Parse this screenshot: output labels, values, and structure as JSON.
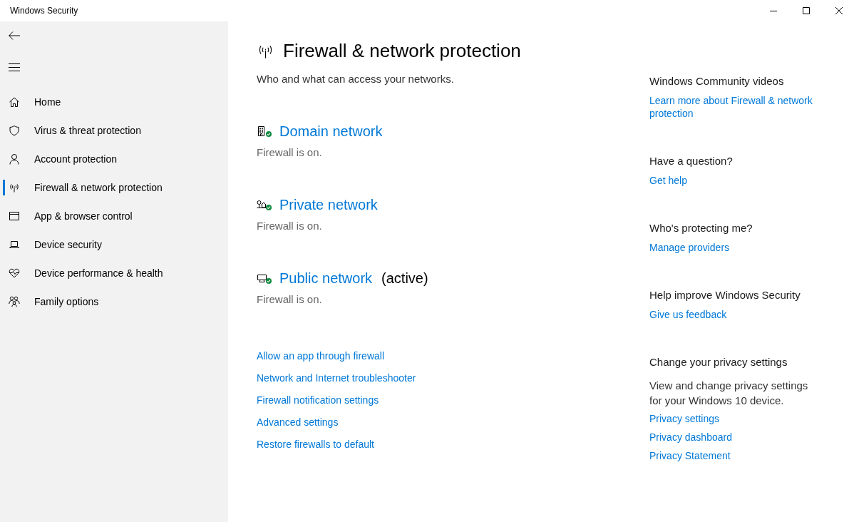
{
  "window": {
    "title": "Windows Security"
  },
  "sidebar": {
    "items": [
      {
        "label": "Home",
        "selected": false
      },
      {
        "label": "Virus & threat protection",
        "selected": false
      },
      {
        "label": "Account protection",
        "selected": false
      },
      {
        "label": "Firewall & network protection",
        "selected": true
      },
      {
        "label": "App & browser control",
        "selected": false
      },
      {
        "label": "Device security",
        "selected": false
      },
      {
        "label": "Device performance & health",
        "selected": false
      },
      {
        "label": "Family options",
        "selected": false
      }
    ]
  },
  "page": {
    "title": "Firewall & network protection",
    "subtitle": "Who and what can access your networks.",
    "networks": [
      {
        "name": "Domain network",
        "status": "Firewall is on.",
        "firewall_on": true
      },
      {
        "name": "Private network",
        "status": "Firewall is on.",
        "firewall_on": true
      },
      {
        "name": "Public network",
        "note": "(active)",
        "status": "Firewall is on.",
        "firewall_on": true
      }
    ],
    "links": [
      "Allow an app through firewall",
      "Network and Internet troubleshooter",
      "Firewall notification settings",
      "Advanced settings",
      "Restore firewalls to default"
    ]
  },
  "side_panel": {
    "sections": [
      {
        "heading": "Windows Community videos",
        "links": [
          "Learn more about Firewall & network protection"
        ]
      },
      {
        "heading": "Have a question?",
        "links": [
          "Get help"
        ]
      },
      {
        "heading": "Who's protecting me?",
        "links": [
          "Manage providers"
        ]
      },
      {
        "heading": "Help improve Windows Security",
        "links": [
          "Give us feedback"
        ]
      },
      {
        "heading": "Change your privacy settings",
        "text": "View and change privacy settings for your Windows 10 device.",
        "links": [
          "Privacy settings",
          "Privacy dashboard",
          "Privacy Statement"
        ]
      }
    ]
  }
}
